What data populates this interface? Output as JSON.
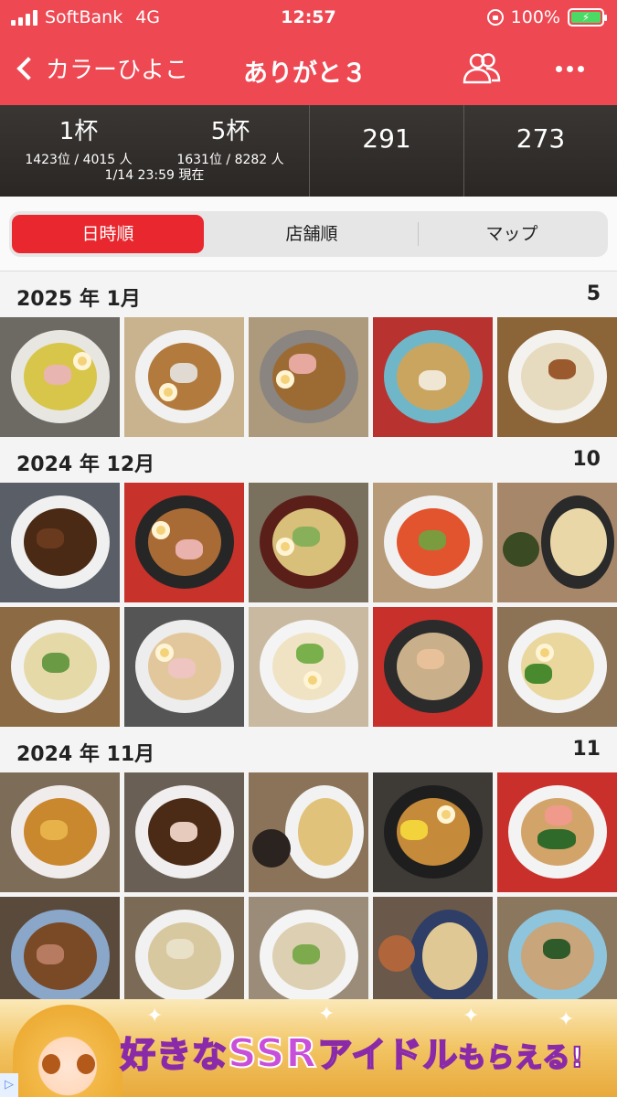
{
  "status_bar": {
    "carrier": "SoftBank",
    "network": "4G",
    "time": "12:57",
    "battery": "100%",
    "icons": [
      "signal-icon",
      "rotation-lock-icon",
      "battery-charging-icon"
    ]
  },
  "nav": {
    "back_label": "カラーひよこ",
    "title": "ありがと３",
    "icons": [
      "back-chevron-icon",
      "people-icon",
      "more-icon"
    ]
  },
  "stats": {
    "cups_a": "1杯",
    "rank_a": "1423位 / 4015 人",
    "cups_b": "5杯",
    "rank_b": "1631位 / 8282 人",
    "as_of": "1/14 23:59 現在",
    "count_1": "291",
    "count_2": "273"
  },
  "tabs": {
    "items": [
      "日時順",
      "店舗順",
      "マップ"
    ],
    "active": "日時順"
  },
  "sections": [
    {
      "label": "2025 年 1月",
      "count": "5"
    },
    {
      "label": "2024 年 12月",
      "count": "10"
    },
    {
      "label": "2024 年 11月",
      "count": "11"
    }
  ],
  "ad": {
    "text_a": "好きな",
    "text_ssr": "SSR",
    "text_b": "アイドル",
    "text_c": "もらえる!",
    "adchoices": "▷"
  },
  "colors": {
    "accent": "#ee4852",
    "tab_active": "#e9272e",
    "stats_bg": "#2f2c2a"
  }
}
